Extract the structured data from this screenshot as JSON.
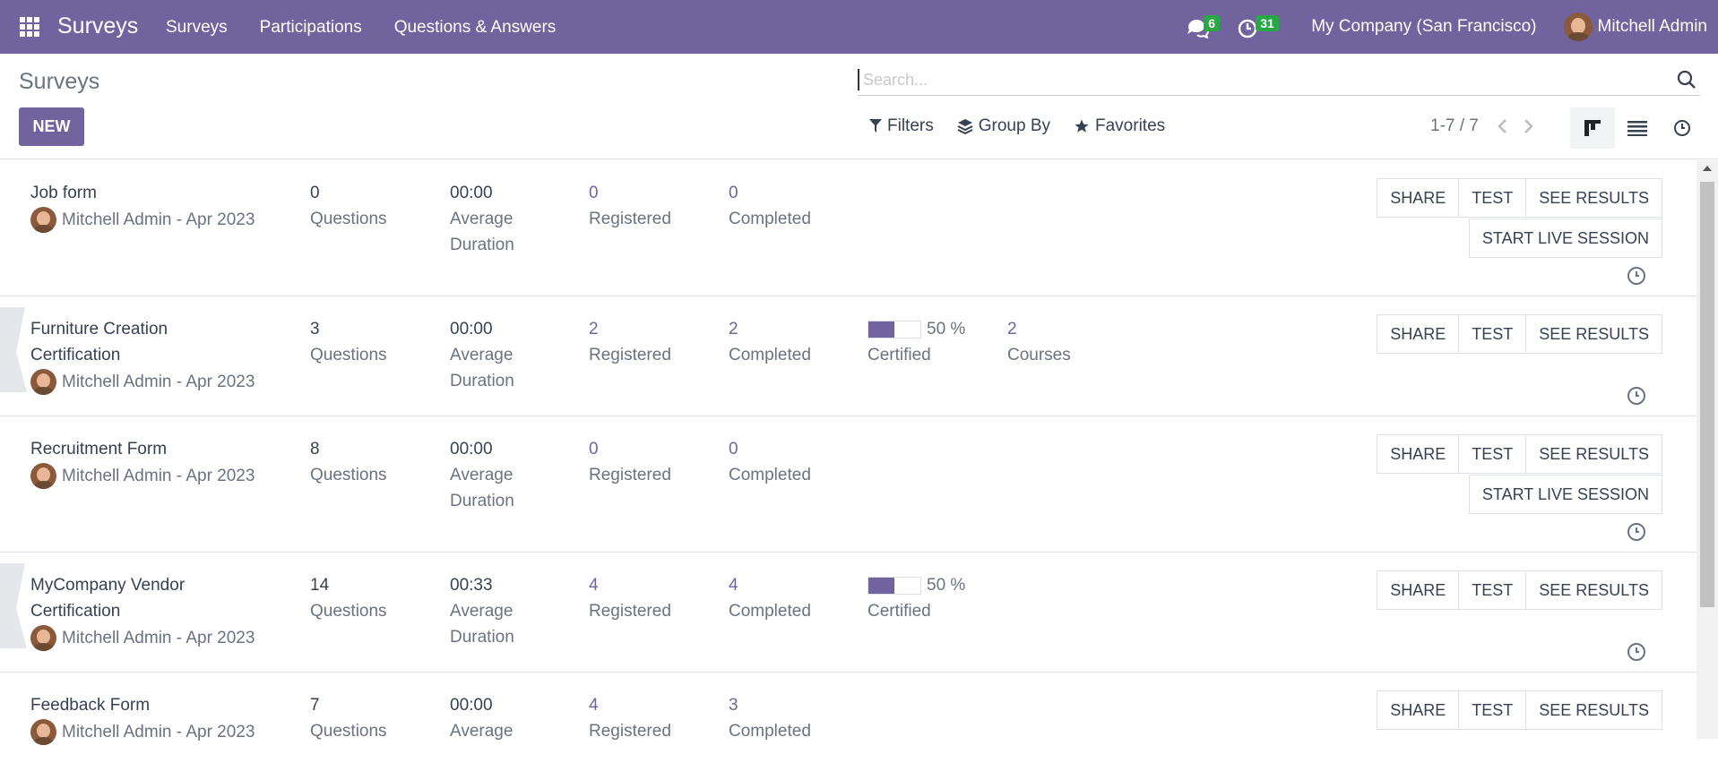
{
  "navbar": {
    "brand": "Surveys",
    "menu": [
      "Surveys",
      "Participations",
      "Questions & Answers"
    ],
    "messages_count": "6",
    "activities_count": "31",
    "company": "My Company (San Francisco)",
    "user": "Mitchell Admin",
    "colors": {
      "navbar_bg": "#71639e",
      "badge": "#28a745"
    }
  },
  "control_panel": {
    "title": "Surveys",
    "new_label": "NEW",
    "search_placeholder": "Search...",
    "filters_label": "Filters",
    "groupby_label": "Group By",
    "favorites_label": "Favorites",
    "pager": "1-7 / 7",
    "views": [
      "kanban-icon",
      "list-icon",
      "activity-icon"
    ]
  },
  "labels": {
    "questions": "Questions",
    "average": "Average",
    "duration": "Duration",
    "registered": "Registered",
    "completed": "Completed",
    "certified": "Certified",
    "courses": "Courses",
    "share": "SHARE",
    "test": "TEST",
    "see_results": "SEE RESULTS",
    "start_live": "START LIVE SESSION"
  },
  "surveys": [
    {
      "name": "Job form",
      "author": "Mitchell Admin - Apr 2023",
      "questions": "0",
      "duration": "00:00",
      "registered": "0",
      "completed": "0"
    },
    {
      "name": "Furniture Creation Certification",
      "author": "Mitchell Admin - Apr 2023",
      "questions": "3",
      "duration": "00:00",
      "registered": "2",
      "completed": "2",
      "certified_pct": "50 %",
      "certified_fraction": 0.5,
      "courses": "2"
    },
    {
      "name": "Recruitment Form",
      "author": "Mitchell Admin - Apr 2023",
      "questions": "8",
      "duration": "00:00",
      "registered": "0",
      "completed": "0"
    },
    {
      "name": "MyCompany Vendor Certification",
      "author": "Mitchell Admin - Apr 2023",
      "questions": "14",
      "duration": "00:33",
      "registered": "4",
      "completed": "4",
      "certified_pct": "50 %",
      "certified_fraction": 0.5
    },
    {
      "name": "Feedback Form",
      "author": "Mitchell Admin - Apr 2023",
      "questions": "7",
      "duration": "00:00",
      "registered": "4",
      "completed": "3"
    }
  ]
}
